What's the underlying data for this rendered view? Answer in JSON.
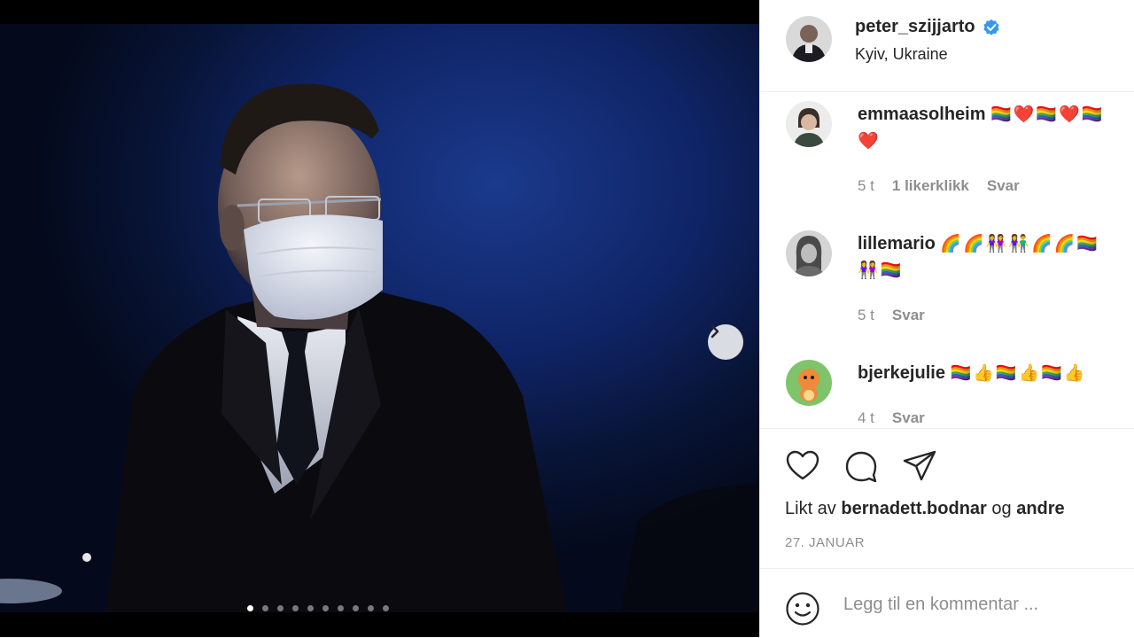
{
  "post": {
    "author": "peter_szijjarto",
    "verified_icon": "verified-badge-icon",
    "location": "Kyiv, Ukraine",
    "carousel": {
      "total_images": 10,
      "active_index": 0
    },
    "next_icon": "chevron-right-icon"
  },
  "comments": [
    {
      "user": "emmaasolheim",
      "text_line1": "🏳️‍🌈❤️🏳️‍🌈❤️🏳️‍🌈",
      "text_line2": "❤️",
      "time": "5 t",
      "likes": "1 likerklikk",
      "reply": "Svar"
    },
    {
      "user": "lillemario",
      "text_line1": "🌈🌈👭👫🌈🌈🏳️‍🌈",
      "text_line2": "👭🏳️‍🌈",
      "time": "5 t",
      "likes": "",
      "reply": "Svar"
    },
    {
      "user": "bjerkejulie",
      "text_line1": "🏳️‍🌈👍🏳️‍🌈👍🏳️‍🌈👍",
      "text_line2": "",
      "time": "4 t",
      "likes": "",
      "reply": "Svar"
    }
  ],
  "actions": {
    "like_icon": "heart-icon",
    "comment_icon": "comment-bubble-icon",
    "share_icon": "paper-plane-icon",
    "liked_by_prefix": "Likt av",
    "liked_by_user": "bernadett.bodnar",
    "liked_by_joiner": "og",
    "liked_by_others": "andre",
    "date": "27. JANUAR"
  },
  "add_comment": {
    "emoji_icon": "smiley-icon",
    "placeholder": "Legg til en kommentar ..."
  },
  "colors": {
    "verified": "#3897f0",
    "muted": "#8e8e8e",
    "text": "#262626",
    "divider": "#efefef"
  }
}
